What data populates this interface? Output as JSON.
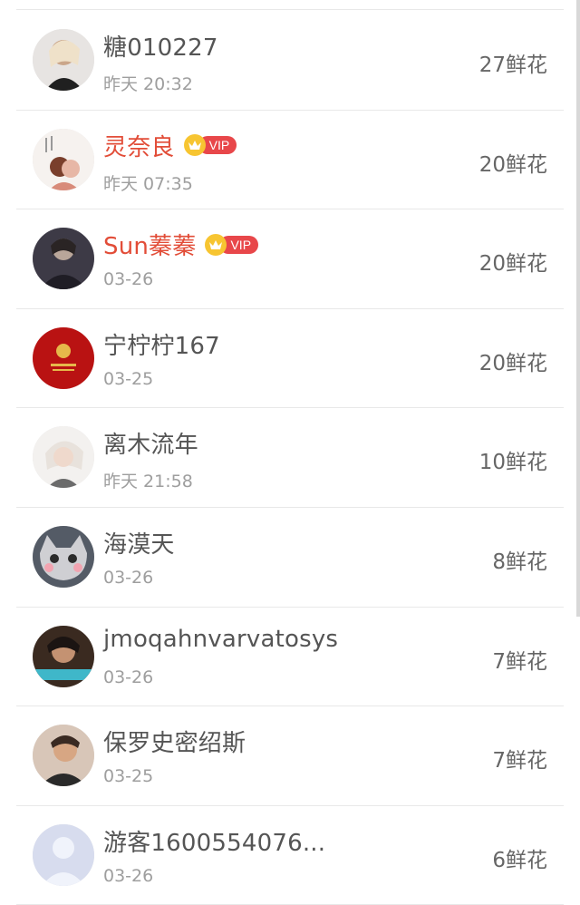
{
  "rows": [
    {
      "name": "糖010227",
      "time": "昨天 20:32",
      "flowers": "27鲜花",
      "vip": false,
      "avatar": "girl-photo"
    },
    {
      "name": "灵奈良",
      "time": "昨天 07:35",
      "flowers": "20鲜花",
      "vip": true,
      "avatar": "anime-couple"
    },
    {
      "name": "Sun蓁蓁",
      "time": "03-26",
      "flowers": "20鲜花",
      "vip": true,
      "avatar": "dark-portrait"
    },
    {
      "name": "宁柠柠167",
      "time": "03-25",
      "flowers": "20鲜花",
      "vip": false,
      "avatar": "red-logo"
    },
    {
      "name": "离木流年",
      "time": "昨天 21:58",
      "flowers": "10鲜花",
      "vip": false,
      "avatar": "anime-boy"
    },
    {
      "name": "海漠天",
      "time": "03-26",
      "flowers": "8鲜花",
      "vip": false,
      "avatar": "cat"
    },
    {
      "name": "jmoqahnvarvatosys",
      "time": "03-26",
      "flowers": "7鲜花",
      "vip": false,
      "avatar": "smoking-man"
    },
    {
      "name": "保罗史密绍斯",
      "time": "03-25",
      "flowers": "7鲜花",
      "vip": false,
      "avatar": "young-man"
    },
    {
      "name": "游客1600554076...",
      "time": "03-26",
      "flowers": "6鲜花",
      "vip": false,
      "avatar": "default-user"
    }
  ],
  "vip_label": "VIP",
  "colors": {
    "vip_name": "#e24d38",
    "normal_name": "#555555",
    "badge": "#e8474a",
    "crown": "#f7c531"
  }
}
